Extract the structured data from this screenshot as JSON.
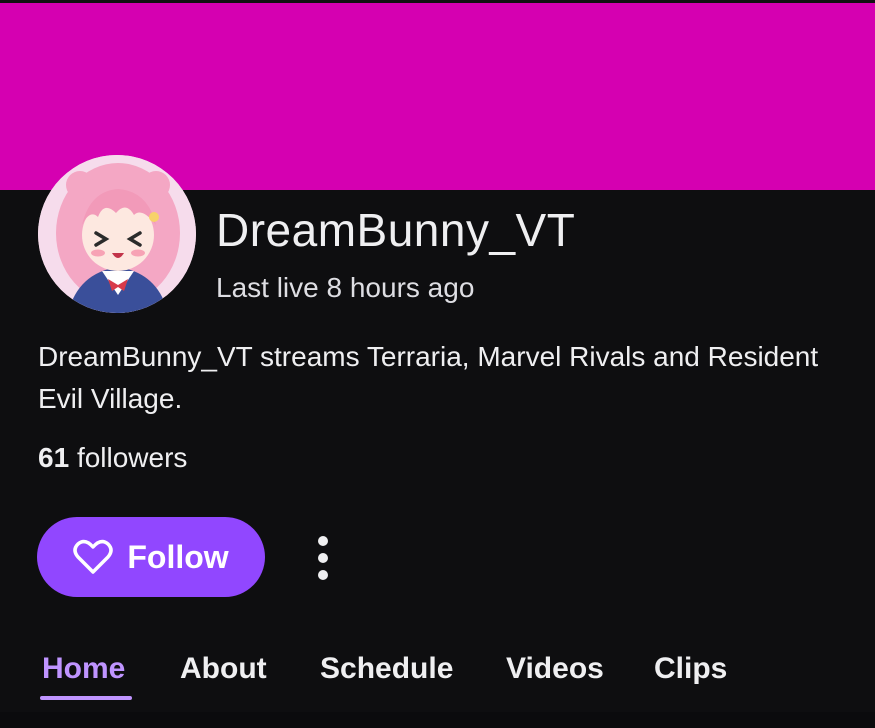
{
  "colors": {
    "banner": "#d500b1",
    "background": "#0e0e10",
    "accent": "#9147ff",
    "active_tab": "#bf94ff"
  },
  "channel": {
    "name": "DreamBunny_VT",
    "last_live": "Last live 8 hours ago",
    "description": "DreamBunny_VT streams Terraria, Marvel Rivals and Resident Evil Village.",
    "followers_count": "61",
    "followers_label": "followers",
    "avatar_icon": "anime-girl-avatar-icon"
  },
  "actions": {
    "follow_label": "Follow",
    "follow_icon": "heart-outline-icon",
    "more_icon": "vertical-ellipsis-icon"
  },
  "tabs": [
    {
      "label": "Home",
      "active": true
    },
    {
      "label": "About",
      "active": false
    },
    {
      "label": "Schedule",
      "active": false
    },
    {
      "label": "Videos",
      "active": false
    },
    {
      "label": "Clips",
      "active": false
    }
  ]
}
